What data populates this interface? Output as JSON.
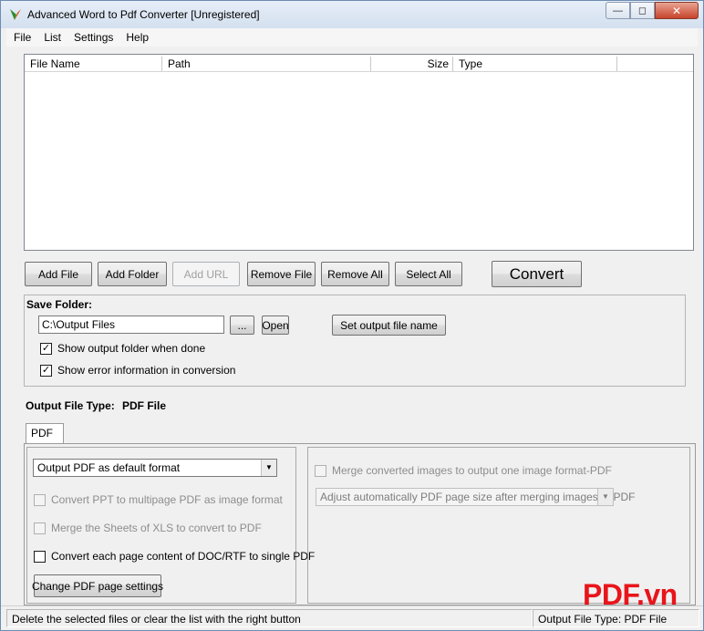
{
  "window": {
    "title": "Advanced Word to Pdf Converter [Unregistered]",
    "controls": {
      "minimize": "—",
      "maximize": "◻",
      "close": "✕"
    }
  },
  "menu": [
    "File",
    "List",
    "Settings",
    "Help"
  ],
  "file_list": {
    "columns": [
      "File Name",
      "Path",
      "Size",
      "Type"
    ],
    "rows": []
  },
  "toolbar": {
    "add_file": "Add File",
    "add_folder": "Add Folder",
    "add_url": "Add URL",
    "remove_file": "Remove File",
    "remove_all": "Remove All",
    "select_all": "Select All",
    "convert": "Convert"
  },
  "save_folder": {
    "label": "Save Folder:",
    "path_value": "C:\\Output Files",
    "browse_label": "...",
    "open_label": "Open",
    "set_output_name_label": "Set output file name",
    "show_output_folder": {
      "label": "Show output folder when done",
      "checked": true
    },
    "show_error_info": {
      "label": "Show error information in conversion",
      "checked": true
    }
  },
  "output_type": {
    "label": "Output File Type:",
    "value": "PDF File"
  },
  "tabs": [
    "PDF"
  ],
  "pdf_options": {
    "format_select": "Output PDF as default format",
    "ppt_multipage": {
      "label": "Convert PPT to multipage PDF as image format",
      "checked": false,
      "enabled": false
    },
    "merge_xls": {
      "label": "Merge the Sheets of XLS to convert to PDF",
      "checked": false,
      "enabled": false
    },
    "each_page_single": {
      "label": "Convert each page content of DOC/RTF to single PDF",
      "checked": false,
      "enabled": true
    },
    "change_page_settings": "Change PDF page settings",
    "merge_images": {
      "label": "Merge converted images to output one image format-PDF",
      "checked": false,
      "enabled": false
    },
    "adjust_select": "Adjust automatically PDF page size after merging images to PDF"
  },
  "status": {
    "message": "Delete the selected files or clear the list with the right button",
    "output_type": "Output File Type:  PDF File"
  },
  "watermark": "PDF.vn",
  "colors": {
    "watermark": "#e8151b",
    "close_button": "#c7432a"
  }
}
